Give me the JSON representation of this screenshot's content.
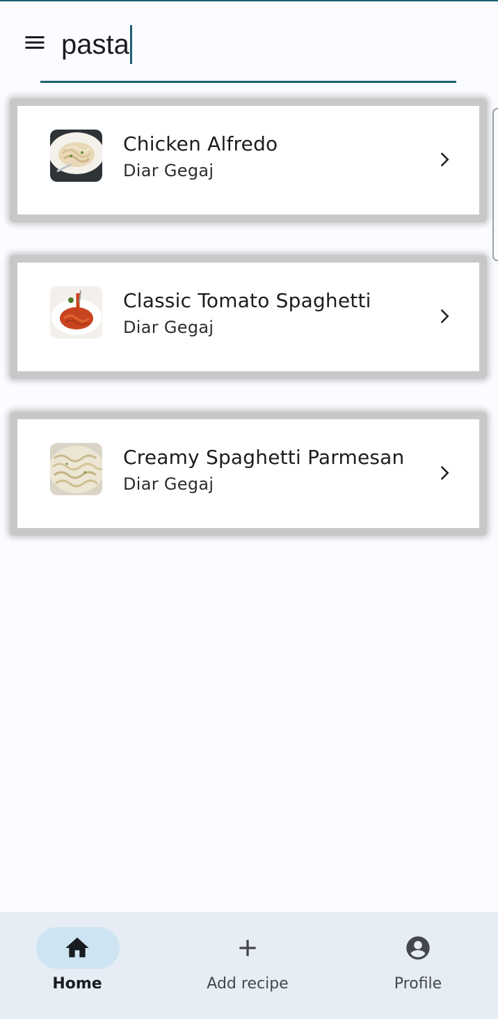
{
  "search": {
    "query": "pasta"
  },
  "recipes": [
    {
      "title": "Chicken Alfredo",
      "author": "Diar Gegaj",
      "thumbnail": "fettuccine-alfredo-photo"
    },
    {
      "title": "Classic Tomato Spaghetti",
      "author": "Diar Gegaj",
      "thumbnail": "tomato-spaghetti-photo"
    },
    {
      "title": "Creamy Spaghetti Parmesan",
      "author": "Diar Gegaj",
      "thumbnail": "spaghetti-parmesan-photo"
    }
  ],
  "nav": {
    "items": [
      {
        "label": "Home",
        "icon": "home-icon",
        "active": true
      },
      {
        "label": "Add recipe",
        "icon": "plus-icon",
        "active": false
      },
      {
        "label": "Profile",
        "icon": "account-circle-icon",
        "active": false
      }
    ]
  },
  "colors": {
    "accent": "#1e5f74",
    "background": "#fbfcff",
    "nav_background": "#e7edf5",
    "nav_active_pill": "#cfe4f2"
  }
}
